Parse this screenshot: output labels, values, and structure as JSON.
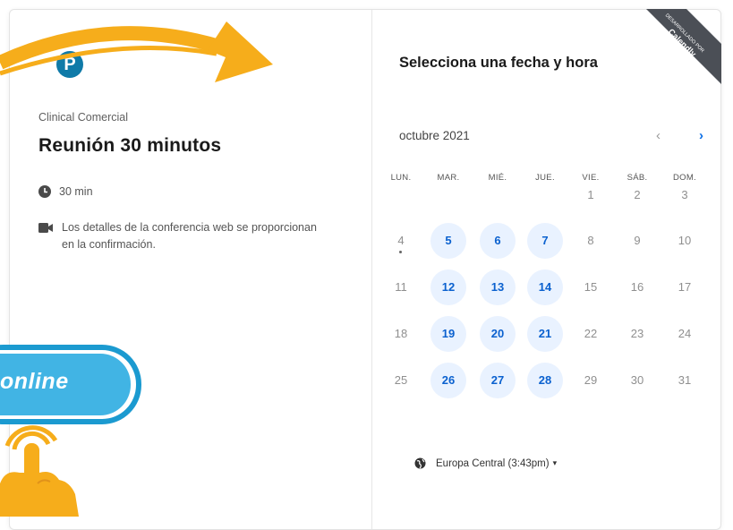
{
  "left": {
    "logo_letter": "P",
    "company": "Clinical Comercial",
    "event_title": "Reunión 30 minutos",
    "duration": "30 min",
    "conference_text": "Los detalles de la conferencia web se proporcionan en la confirmación."
  },
  "overlay": {
    "online_text": "online"
  },
  "ribbon": {
    "line1": "DESARROLLADO POR",
    "line2": "Calendly"
  },
  "calendar": {
    "title": "Selecciona una fecha y hora",
    "month_label": "octubre 2021",
    "prev_icon": "chevron-left-icon",
    "next_icon": "chevron-right-icon",
    "weekdays": [
      "LUN.",
      "MAR.",
      "MIÉ.",
      "JUE.",
      "VIE.",
      "SÁB.",
      "DOM."
    ],
    "days": [
      {
        "n": "1",
        "avail": false
      },
      {
        "n": "2",
        "avail": false
      },
      {
        "n": "3",
        "avail": false
      },
      {
        "n": "4",
        "avail": false,
        "today": true
      },
      {
        "n": "5",
        "avail": true
      },
      {
        "n": "6",
        "avail": true
      },
      {
        "n": "7",
        "avail": true
      },
      {
        "n": "8",
        "avail": false
      },
      {
        "n": "9",
        "avail": false
      },
      {
        "n": "10",
        "avail": false
      },
      {
        "n": "11",
        "avail": false
      },
      {
        "n": "12",
        "avail": true
      },
      {
        "n": "13",
        "avail": true
      },
      {
        "n": "14",
        "avail": true
      },
      {
        "n": "15",
        "avail": false
      },
      {
        "n": "16",
        "avail": false
      },
      {
        "n": "17",
        "avail": false
      },
      {
        "n": "18",
        "avail": false
      },
      {
        "n": "19",
        "avail": true
      },
      {
        "n": "20",
        "avail": true
      },
      {
        "n": "21",
        "avail": true
      },
      {
        "n": "22",
        "avail": false
      },
      {
        "n": "23",
        "avail": false
      },
      {
        "n": "24",
        "avail": false
      },
      {
        "n": "25",
        "avail": false
      },
      {
        "n": "26",
        "avail": true
      },
      {
        "n": "27",
        "avail": true
      },
      {
        "n": "28",
        "avail": true
      },
      {
        "n": "29",
        "avail": false
      },
      {
        "n": "30",
        "avail": false
      },
      {
        "n": "31",
        "avail": false
      }
    ],
    "timezone": "Europa Central (3:43pm)"
  },
  "colors": {
    "accent": "#0b61cf",
    "available_bg": "#e9f2ff",
    "banner": "#41b4e4",
    "arrow": "#f6ad1b"
  }
}
